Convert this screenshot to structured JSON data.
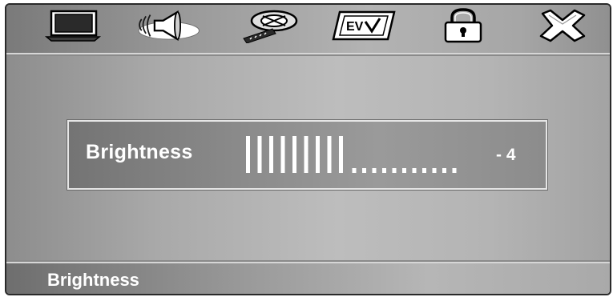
{
  "menu": {
    "items": [
      {
        "name": "tv-icon",
        "selected": false
      },
      {
        "name": "speaker-icon",
        "selected": true
      },
      {
        "name": "film-reel-icon",
        "selected": false
      },
      {
        "name": "setup-icon",
        "selected": false
      },
      {
        "name": "lock-icon",
        "selected": false
      },
      {
        "name": "exit-icon",
        "selected": false
      }
    ]
  },
  "setting": {
    "label": "Brightness",
    "value": "- 4",
    "level": {
      "filled": 9,
      "empty": 11
    }
  },
  "status": {
    "text": "Brightness"
  },
  "colors": {
    "text": "#ffffff",
    "panel_border": "#e6e6e6",
    "background": "#b4b4b4"
  }
}
